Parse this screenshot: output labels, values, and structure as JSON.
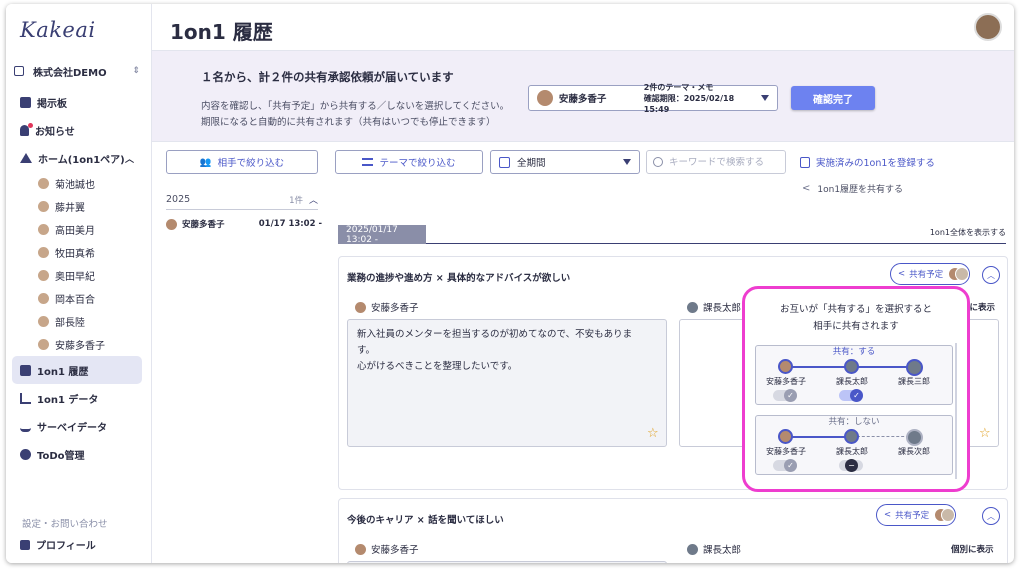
{
  "app": {
    "logo": "Kakeai",
    "page_title": "1on1 履歴"
  },
  "sidebar": {
    "company": "株式会社DEMO",
    "items": [
      {
        "label": "掲示板"
      },
      {
        "label": "お知らせ"
      },
      {
        "label": "ホーム(1on1ペア)"
      }
    ],
    "pairs": [
      "菊池誠也",
      "藤井翼",
      "高田美月",
      "牧田真希",
      "奥田早紀",
      "岡本百合",
      "部長陸",
      "安藤多香子"
    ],
    "bottom_items": [
      {
        "label": "1on1 履歴"
      },
      {
        "label": "1on1 データ"
      },
      {
        "label": "サーベイデータ"
      },
      {
        "label": "ToDo管理"
      }
    ],
    "settings": "設定・お問い合わせ",
    "profile": "プロフィール"
  },
  "banner": {
    "title": "１名から、計２件の共有承認依頼が届いています",
    "desc1": "内容を確認し、「共有予定」から共有する／しないを選択してください。",
    "desc2": "期限になると自動的に共有されます（共有はいつでも停止できます）",
    "select_name": "安藤多香子",
    "select_meta1": "2件のテーマ・メモ",
    "select_meta2": "確認期限：2025/02/18 15:49",
    "confirm": "確認完了"
  },
  "filters": {
    "partner": "相手で絞り込む",
    "theme": "テーマで絞り込む",
    "period": "全期間",
    "search_placeholder": "キーワードで検索する",
    "register": "実施済みの1on1を登録する",
    "share_history": "1on1履歴を共有する"
  },
  "history_list": {
    "year": "2025",
    "count": "1件",
    "item_name": "安藤多香子",
    "item_date": "01/17 13:02 -"
  },
  "timeline": {
    "tag": "2025/01/17 13:02 -",
    "show_all": "1on1全体を表示する"
  },
  "card1": {
    "title": "業務の進捗や進め方 × 具体的なアドバイスが欲しい",
    "share_status": "共有予定",
    "left_author": "安藤多香子",
    "left_text1": "新入社員のメンターを担当するのが初めてなので、不安もありま",
    "left_text2": "す。",
    "left_text3": "心がけるべきことを整理したいです。",
    "right_author": "課長太郎",
    "indiv": "別に表示"
  },
  "card2": {
    "title": "今後のキャリア × 話を聞いてほしい",
    "share_status": "共有予定",
    "left_author": "安藤多香子",
    "right_author": "課長太郎",
    "indiv": "個別に表示"
  },
  "popup": {
    "desc1": "お互いが「共有する」を選択すると",
    "desc2": "相手に共有されます",
    "share_yes": "共有：する",
    "share_no": "共有：しない",
    "p1_names": [
      "安藤多香子",
      "課長太郎",
      "課長三郎"
    ],
    "p2_names": [
      "安藤多香子",
      "課長太郎",
      "課長次郎"
    ]
  },
  "colors": {
    "accent": "#4a57c8",
    "highlight": "#ee3dcf",
    "button": "#6d82f0"
  }
}
